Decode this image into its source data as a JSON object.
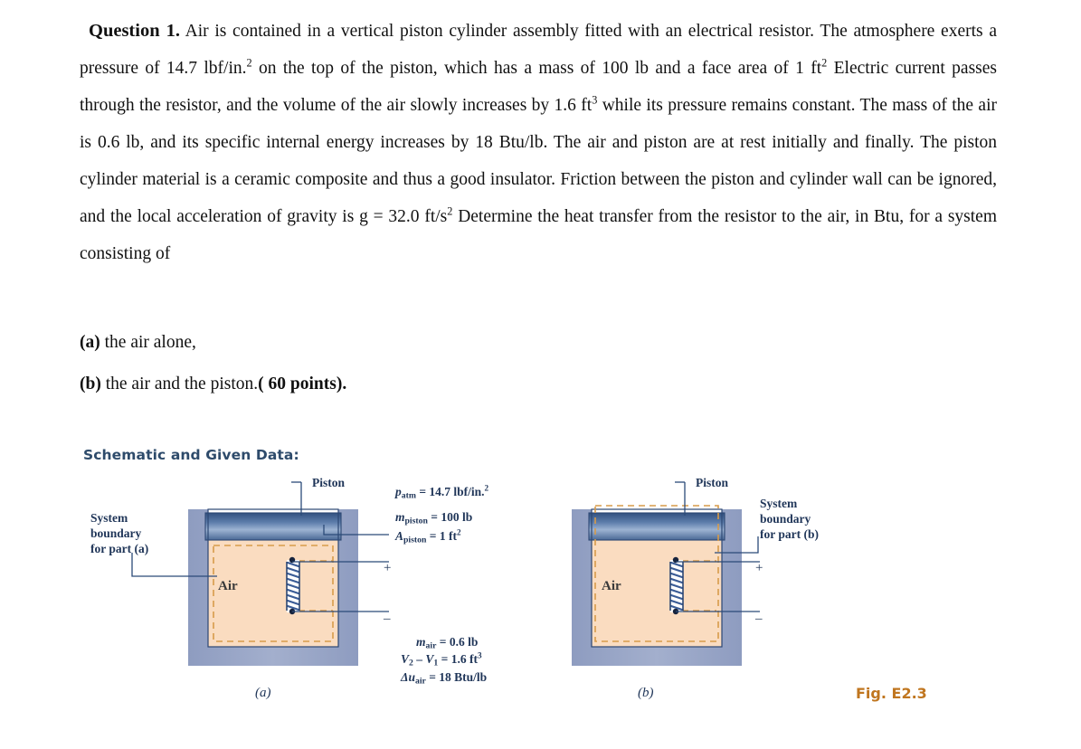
{
  "question": {
    "lead": "Question 1.",
    "body": "Air is contained in a vertical piston cylinder assembly fitted with an electrical resistor. The atmosphere exerts a pressure of 14.7 lbf/in.",
    "sup1": "2",
    "body2": " on the top of the piston, which has a mass of 100 lb  and a face area of 1 ft",
    "sup2": "2",
    "body3": " Electric current passes through the resistor, and the volume of the air slowly increases by 1.6 ft",
    "sup3": "3",
    "body4": " while its pressure remains  constant. The mass of the air is 0.6 lb, and its specific internal energy increases by 18 Btu/lb. The air and piston are at rest initially and finally. The piston cylinder material is a ceramic composite and thus a good insulator. Friction between the piston and cylinder wall can be ignored, and the local acceleration of gravity is g = 32.0 ft/s",
    "sup4": "2",
    "body5": " Determine the heat transfer from the resistor to the air, in Btu, for a system consisting of",
    "part_a_marker": "(a)",
    "part_a_text": " the air alone,",
    "part_b_marker": "(b)",
    "part_b_text": " the air and the piston.",
    "part_b_points": "( 60 points)."
  },
  "schematic": {
    "heading": "Schematic and Given Data:",
    "figure_number": "Fig. E2.3",
    "caption_a": "(a)",
    "caption_b": "(b)",
    "piston_label_a": "Piston",
    "piston_label_b": "Piston",
    "air_label_a": "Air",
    "air_label_b": "Air",
    "boundary_a_line1": "System",
    "boundary_a_line2": "boundary",
    "boundary_a_line3": "for part (a)",
    "boundary_b_line1": "System",
    "boundary_b_line2": "boundary",
    "boundary_b_line3": "for part (b)",
    "plus_a": "+",
    "minus_a": "–",
    "plus_b": "+",
    "minus_b": "–",
    "given": {
      "p_atm_sym": "p",
      "p_atm_sub": "atm",
      "p_atm_val": "= 14.7 lbf/in.",
      "p_atm_sup": "2",
      "m_piston_sym": "m",
      "m_piston_sub": "piston",
      "m_piston_val": "= 100 lb",
      "a_piston_sym": "A",
      "a_piston_sub": "piston",
      "a_piston_val": "= 1 ft",
      "a_piston_sup": "2",
      "m_air_sym": "m",
      "m_air_sub": "air",
      "m_air_val": "= 0.6 lb",
      "vol_sym1": "V",
      "vol_sub1": "2",
      "vol_dash": " – ",
      "vol_sym2": "V",
      "vol_sub2": "1",
      "vol_val": "= 1.6 ft",
      "vol_sup": "3",
      "du_sym": "Δu",
      "du_sub": "air",
      "du_val": "= 18 Btu/lb"
    }
  },
  "colors": {
    "cylinder_wall": "#9aa7c8",
    "air_fill": "#fadcc0",
    "piston_dark": "#2f4f7f",
    "piston_light": "#b9c9e4",
    "boundary_dash": "#d79b4a",
    "leader_line": "#2b4a78",
    "heading": "#2e4b6b",
    "fig_number": "#c0761f"
  }
}
